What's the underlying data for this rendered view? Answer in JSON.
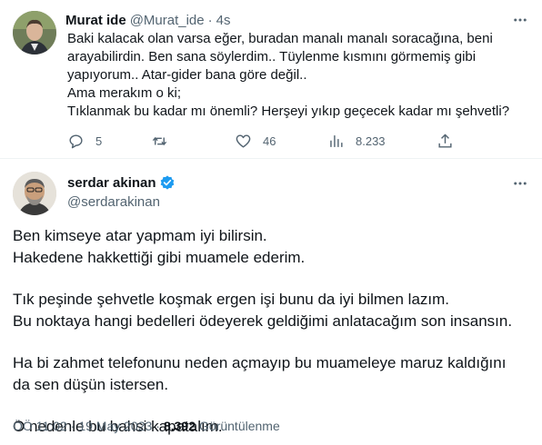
{
  "reply_tweet": {
    "author_name": "Murat ide",
    "author_handle": "@Murat_ide",
    "time_sep": "·",
    "time": "4s",
    "lines": [
      "Baki kalacak olan varsa eğer, buradan manalı manalı soracağına, beni",
      "arayabilirdin. Ben sana söylerdim.. Tüylenme kısmını görmemiş gibi",
      "yapıyorum.. Atar-gider bana göre değil..",
      "Ama merakım o ki;",
      "Tıklanmak bu kadar mı önemli? Herşeyi yıkıp geçecek kadar mı şehvetli?"
    ],
    "actions": {
      "replies": "5",
      "retweets": "",
      "likes": "46",
      "views": "8.233"
    },
    "icons": [
      "reply-icon",
      "retweet-icon",
      "like-icon",
      "views-icon",
      "share-icon",
      "more-icon"
    ]
  },
  "main_tweet": {
    "author_name": "serdar akinan",
    "author_handle": "@serdarakinan",
    "verified_color": "#1d9bf0",
    "paragraphs": [
      [
        "Ben kimseye atar yapmam iyi bilirsin.",
        "Hakedene hakkettiği gibi muamele ederim."
      ],
      [
        "Tık peşinde şehvetle koşmak ergen işi bunu da iyi bilmen lazım.",
        "Bu noktaya hangi bedelleri ödeyerek geldiğimi anlatacağım son insansın."
      ],
      [
        "Ha bi zahmet telefonunu neden açmayıp bu muameleye maruz kaldığını",
        "da sen düşün istersen."
      ],
      [
        "O nedenle bu bahsi kapatalım."
      ]
    ],
    "meta": {
      "time": "ÖÖ 11:02",
      "sep": "·",
      "date": "19 May 2023",
      "sep2": "·",
      "views_count": "8.392",
      "views_label": "Görüntülenme"
    }
  },
  "colors": {
    "text": "#0f1419",
    "muted": "#536471",
    "divider": "#eff3f4",
    "accent": "#1d9bf0"
  }
}
